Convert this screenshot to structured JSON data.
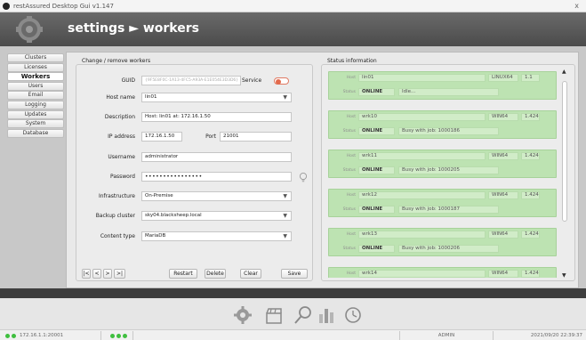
{
  "window": {
    "title": "restAssured Desktop Gui v1.147",
    "close_glyph": "x"
  },
  "header": {
    "breadcrumb": "settings ► workers"
  },
  "sidebar": {
    "items": [
      {
        "label": "Clusters"
      },
      {
        "label": "Licenses"
      },
      {
        "label": "Workers",
        "active": true
      },
      {
        "label": "Users"
      },
      {
        "label": "Email"
      },
      {
        "label": "Logging"
      },
      {
        "label": "Updates"
      },
      {
        "label": "System"
      },
      {
        "label": "Database"
      }
    ]
  },
  "form": {
    "title": "Change / remove workers",
    "guid_label": "GUID",
    "guid_value": "{9F5E8F0C-1A13-4FC5-A93A-E1E054E3D3D6}",
    "service_label": "Service",
    "host_label": "Host name",
    "host_value": "lin01",
    "desc_label": "Description",
    "desc_value": "Host: lin01 at: 172.16.1.50",
    "ip_label": "IP address",
    "ip_value": "172.16.1.50",
    "port_label": "Port",
    "port_value": "21001",
    "user_label": "Username",
    "user_value": "administrator",
    "pass_label": "Password",
    "pass_value": "••••••••••••••••",
    "infra_label": "Infrastructure",
    "infra_value": "On-Premise",
    "backup_label": "Backup cluster",
    "backup_value": "sky04.blacksheep.local",
    "ctype_label": "Content type",
    "ctype_value": "MariaDB",
    "dropdown_glyph": "▼",
    "nav": {
      "first": "|<",
      "prev": "<",
      "next": ">",
      "last": ">|"
    },
    "buttons": {
      "restart": "Restart",
      "delete": "Delete",
      "clear": "Clear",
      "save": "Save"
    }
  },
  "status": {
    "title": "Status information",
    "host_label": "Host",
    "status_label": "Status",
    "scroll_up": "▲",
    "scroll_down": "▼",
    "workers": [
      {
        "host": "lin01",
        "os": "LINUX64",
        "version": "1.1",
        "state": "ONLINE",
        "job": "Idle..."
      },
      {
        "host": "wrk10",
        "os": "WIN64",
        "version": "1.424",
        "state": "ONLINE",
        "job": "Busy with job: 1000186"
      },
      {
        "host": "wrk11",
        "os": "WIN64",
        "version": "1.424",
        "state": "ONLINE",
        "job": "Busy with job: 1000205"
      },
      {
        "host": "wrk12",
        "os": "WIN64",
        "version": "1.424",
        "state": "ONLINE",
        "job": "Busy with job: 1000187"
      },
      {
        "host": "wrk13",
        "os": "WIN64",
        "version": "1.424",
        "state": "ONLINE",
        "job": "Busy with job: 1000206"
      },
      {
        "host": "wrk14",
        "os": "WIN64",
        "version": "1.424"
      }
    ]
  },
  "toolbar": {
    "icons": [
      "gear-icon",
      "clapperboard-icon",
      "magnifier-icon",
      "bar-chart-icon",
      "clock-icon"
    ]
  },
  "statusbar": {
    "connection": "172.16.1.1:20001",
    "user": "ADMIN",
    "datetime": "2021/09/20 22:39:37"
  },
  "colors": {
    "accent_green": "#3fbf3f",
    "card_green": "#bde3b2",
    "toggle_red": "#e36a4c",
    "header_gray": "#555555"
  }
}
